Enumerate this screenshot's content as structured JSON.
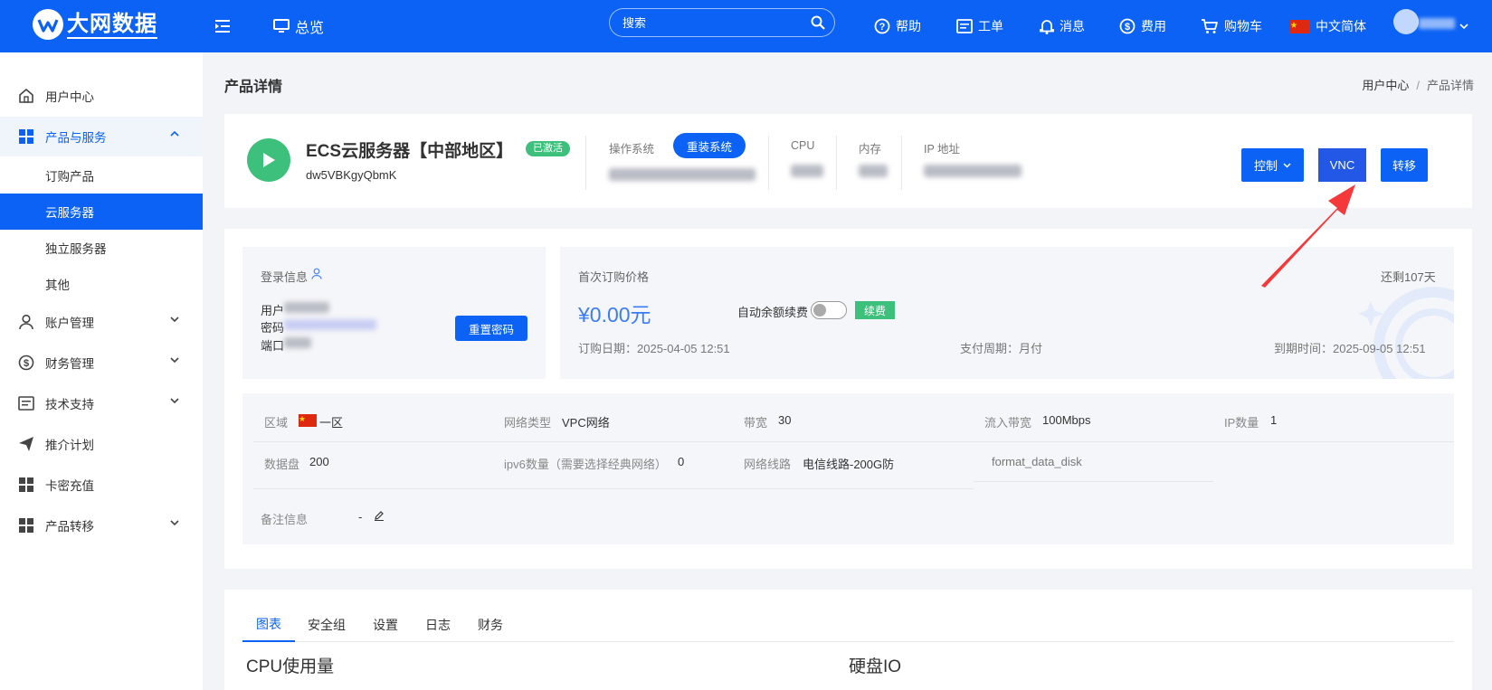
{
  "header": {
    "logo_text": "大网数据",
    "overview": "总览",
    "search_placeholder": "搜索",
    "help": "帮助",
    "ticket": "工单",
    "message": "消息",
    "fee": "费用",
    "cart": "购物车",
    "language": "中文简体"
  },
  "sidebar": {
    "items": [
      {
        "label": "用户中心",
        "icon": "home-icon"
      },
      {
        "label": "产品与服务",
        "icon": "grid-icon"
      },
      {
        "label": "账户管理",
        "icon": "user-icon"
      },
      {
        "label": "财务管理",
        "icon": "dollar-icon"
      },
      {
        "label": "技术支持",
        "icon": "document-icon"
      },
      {
        "label": "推介计划",
        "icon": "send-icon"
      },
      {
        "label": "卡密充值",
        "icon": "grid-icon"
      },
      {
        "label": "产品转移",
        "icon": "grid-icon"
      }
    ],
    "sub_items": [
      "订购产品",
      "云服务器",
      "独立服务器",
      "其他"
    ]
  },
  "page": {
    "title": "产品详情",
    "breadcrumb": [
      "用户中心",
      "产品详情"
    ]
  },
  "product": {
    "name": "ECS云服务器【中部地区】",
    "status": "已激活",
    "id": "dw5VBKgyQbmK",
    "os_label": "操作系统",
    "reinstall": "重装系统",
    "cpu_label": "CPU",
    "mem_label": "内存",
    "ip_label": "IP 地址",
    "control": "控制",
    "vnc": "VNC",
    "transfer": "转移"
  },
  "login": {
    "title": "登录信息",
    "user_label": "用户",
    "password_label": "密码",
    "port_label": "端口",
    "reset_password": "重置密码"
  },
  "billing": {
    "first_price_label": "首次订购价格",
    "remaining": "还剩107天",
    "price": "¥0.00元",
    "auto_renew_label": "自动余额续费",
    "renew": "续费",
    "order_date": "订购日期：2025-04-05 12:51",
    "pay_cycle": "支付周期：月付",
    "expire": "到期时间：2025-09-05 12:51"
  },
  "details": {
    "region_label": "区域",
    "region_value": "一区",
    "network_type_label": "网络类型",
    "network_type_value": "VPC网络",
    "bandwidth_label": "带宽",
    "bandwidth_value": "30",
    "inbound_label": "流入带宽",
    "inbound_value": "100Mbps",
    "ip_count_label": "IP数量",
    "ip_count_value": "1",
    "disk_label": "数据盘",
    "disk_value": "200",
    "ipv6_label": "ipv6数量（需要选择经典网络）",
    "ipv6_value": "0",
    "line_label": "网络线路",
    "line_value": "电信线路-200G防",
    "format_disk": "format_data_disk",
    "remark_label": "备注信息",
    "remark_value": "-"
  },
  "tabs": [
    "图表",
    "安全组",
    "设置",
    "日志",
    "财务"
  ],
  "sections": {
    "cpu": "CPU使用量",
    "disk": "硬盘IO"
  },
  "colors": {
    "primary": "#0b62f5",
    "success": "#3dc07b",
    "arrow": "#f5393b"
  }
}
